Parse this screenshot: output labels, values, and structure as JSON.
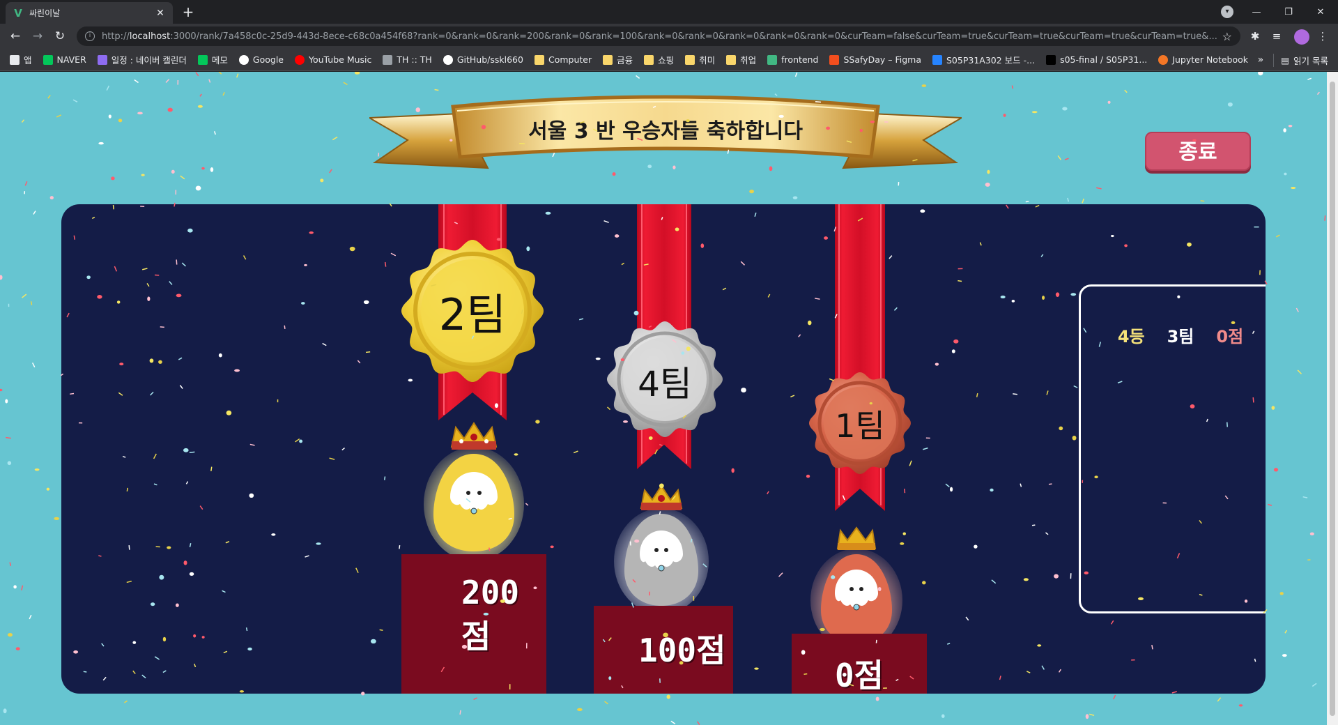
{
  "browser": {
    "tab_title": "싸린이날",
    "tab_favicon": "V",
    "new_tab": "+",
    "url_host": "localhost",
    "url_prefix": "http://",
    "url_rest": ":3000/rank/7a458c0c-25d9-443d-8ece-c68c0a454f68?rank=0&rank=0&rank=200&rank=0&rank=100&rank=0&rank=0&rank=0&rank=0&rank=0&curTeam=false&curTeam=true&curTeam=true&curTeam=true&curTeam=true&..."
  },
  "bookmarks": [
    {
      "label": "앱",
      "icon": "apps-grid-icon",
      "color": "#e8eaed"
    },
    {
      "label": "NAVER",
      "icon": "naver-icon",
      "color": "#03c75a"
    },
    {
      "label": "일정 : 네이버 캘린더",
      "icon": "calendar-icon",
      "color": "#8e6cf1"
    },
    {
      "label": "메모",
      "icon": "memo-icon",
      "color": "#03c75a"
    },
    {
      "label": "Google",
      "icon": "google-icon",
      "color": "#ffffff"
    },
    {
      "label": "YouTube Music",
      "icon": "youtube-music-icon",
      "color": "#ff0000"
    },
    {
      "label": "TH :: TH",
      "icon": "tistory-icon",
      "color": "#9aa0a6"
    },
    {
      "label": "GitHub/sskl660",
      "icon": "github-icon",
      "color": "#ffffff"
    },
    {
      "label": "Computer",
      "icon": "folder-icon",
      "color": "#f9d66b"
    },
    {
      "label": "금융",
      "icon": "folder-icon",
      "color": "#f9d66b"
    },
    {
      "label": "쇼핑",
      "icon": "folder-icon",
      "color": "#f9d66b"
    },
    {
      "label": "취미",
      "icon": "folder-icon",
      "color": "#f9d66b"
    },
    {
      "label": "취업",
      "icon": "folder-icon",
      "color": "#f9d66b"
    },
    {
      "label": "frontend",
      "icon": "vue-icon",
      "color": "#41b883"
    },
    {
      "label": "SSafyDay – Figma",
      "icon": "figma-icon",
      "color": "#f24e1e"
    },
    {
      "label": "S05P31A302 보드 -...",
      "icon": "jira-icon",
      "color": "#2684ff"
    },
    {
      "label": "s05-final / S05P31...",
      "icon": "terminal-icon",
      "color": "#000000"
    },
    {
      "label": "Jupyter Notebook",
      "icon": "jupyter-icon",
      "color": "#f37626"
    }
  ],
  "bookmarks_more": "»",
  "reading_list": "읽기 목록",
  "page": {
    "banner_title": "서울 3 반 우승자들 축하합니다",
    "end_button": "종료",
    "podium": [
      {
        "team": "2팀",
        "score": "200점",
        "medal": "gold",
        "medal_color": "#f2d23c",
        "character_color": "#f3d343"
      },
      {
        "team": "4팀",
        "score": "100점",
        "medal": "silver",
        "medal_color": "#c7c7c7",
        "character_color": "#b5b5b5"
      },
      {
        "team": "1팀",
        "score": "0점",
        "medal": "bronze",
        "medal_color": "#d7654a",
        "character_color": "#df6a4e"
      }
    ],
    "ranking_list": [
      {
        "rank": "4등",
        "team": "3팀",
        "score": "0점"
      }
    ]
  },
  "colors": {
    "page_bg": "#66c5d1",
    "stage_bg": "#141c47",
    "ribbon": "#e3142c",
    "podium": "#7a0b1f",
    "end_button": "#d2546f"
  }
}
